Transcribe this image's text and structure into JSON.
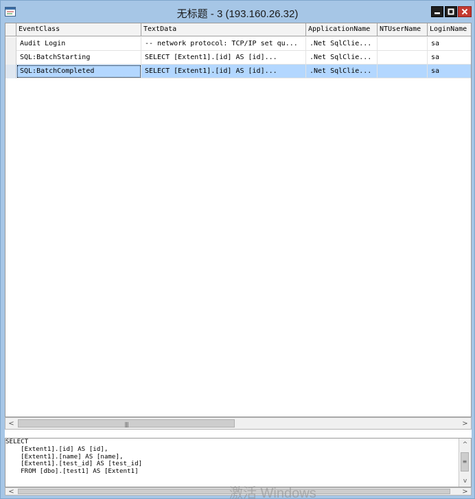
{
  "window": {
    "title": "无标题 - 3 (193.160.26.32)",
    "minimize_glyph": "▁",
    "maximize_glyph": "□",
    "close_glyph": "✕"
  },
  "grid": {
    "columns": [
      "EventClass",
      "TextData",
      "ApplicationName",
      "NTUserName",
      "LoginName"
    ],
    "rows": [
      {
        "event_class": "Audit Login",
        "text_data": "-- network protocol: TCP/IP  set qu...",
        "application": ".Net SqlClie...",
        "nt_user": "",
        "login": "sa",
        "selected": false
      },
      {
        "event_class": "SQL:BatchStarting",
        "text_data": "SELECT       [Extent1].[id] AS [id]...",
        "application": ".Net SqlClie...",
        "nt_user": "",
        "login": "sa",
        "selected": false
      },
      {
        "event_class": "SQL:BatchCompleted",
        "text_data": "SELECT       [Extent1].[id] AS [id]...",
        "application": ".Net SqlClie...",
        "nt_user": "",
        "login": "sa",
        "selected": true
      }
    ]
  },
  "scrollbar": {
    "left_arrow": "<",
    "right_arrow": ">",
    "up_arrow": "^",
    "down_arrow": "v",
    "grip": "|||"
  },
  "detail": {
    "text": "SELECT\n    [Extent1].[id] AS [id],\n    [Extent1].[name] AS [name],\n    [Extent1].[test_id] AS [test_id]\n    FROM [dbo].[test1] AS [Extent1]"
  },
  "watermark": "激活 Windows",
  "colors": {
    "titlebar": "#a6c6e6",
    "selection": "#b3d7ff",
    "close_button": "#c43a31"
  }
}
